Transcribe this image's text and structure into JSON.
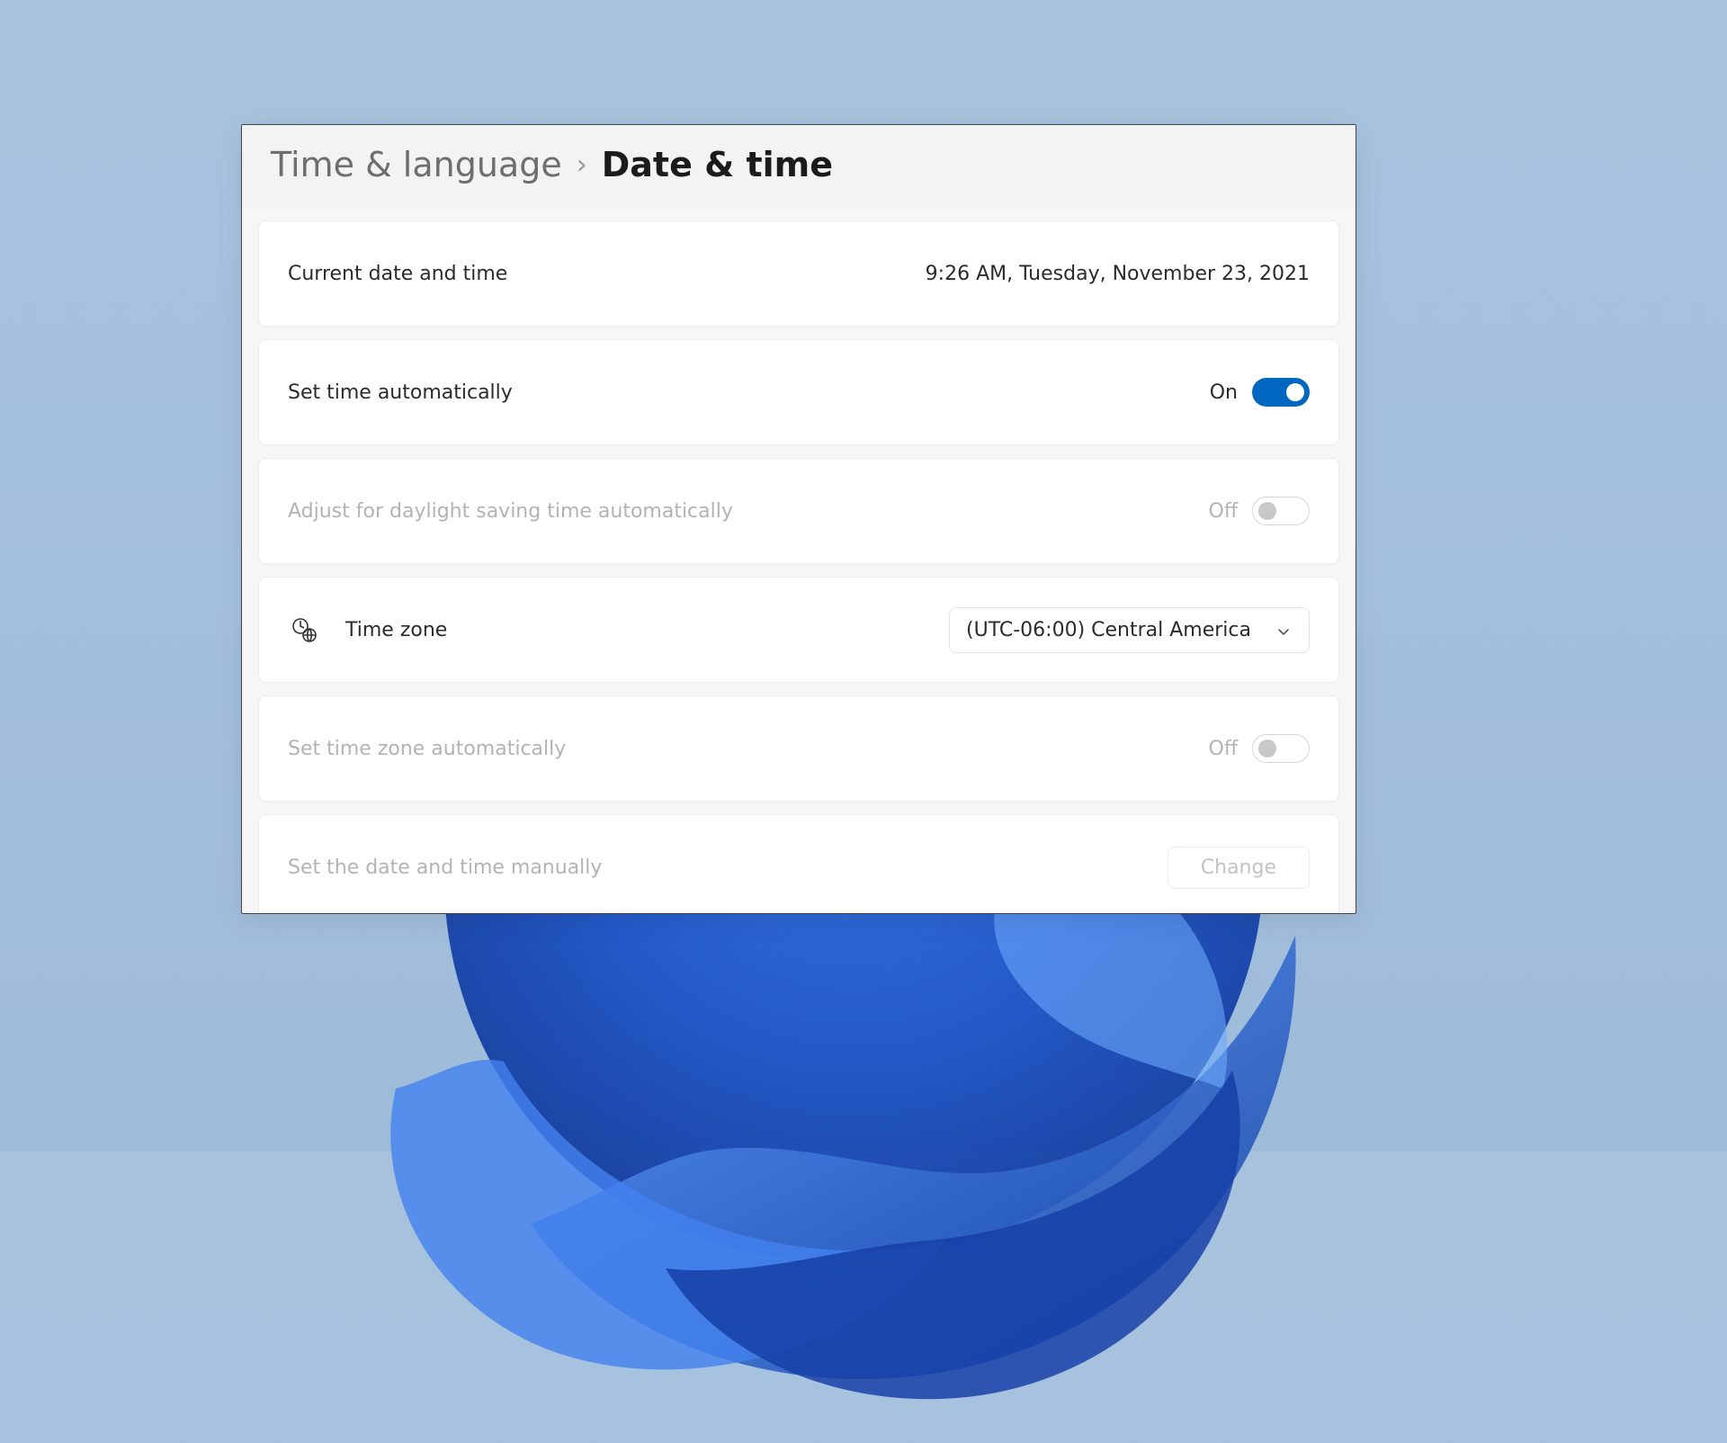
{
  "breadcrumb": {
    "parent": "Time & language",
    "separator": "›",
    "current": "Date & time"
  },
  "rows": {
    "current": {
      "label": "Current date and time",
      "value": "9:26 AM, Tuesday, November 23, 2021"
    },
    "auto_time": {
      "label": "Set time automatically",
      "state": "On",
      "on": true
    },
    "dst": {
      "label": "Adjust for daylight saving time automatically",
      "state": "Off",
      "on": false,
      "disabled": true
    },
    "timezone": {
      "label": "Time zone",
      "selected": "(UTC-06:00) Central America",
      "icon": "clock-globe-icon"
    },
    "auto_tz": {
      "label": "Set time zone automatically",
      "state": "Off",
      "on": false,
      "disabled": true
    },
    "manual": {
      "label": "Set the date and time manually",
      "button": "Change",
      "disabled": true
    }
  }
}
